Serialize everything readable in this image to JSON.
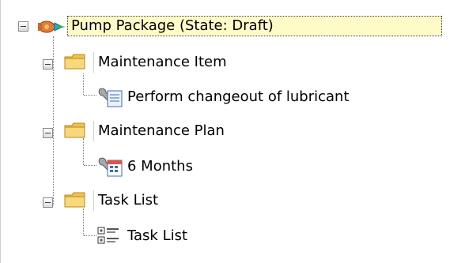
{
  "tree": {
    "root": {
      "label": "Pump Package (State: Draft)",
      "icon": "pump-package-icon"
    },
    "groups": [
      {
        "label": "Maintenance Item",
        "icon": "folder-icon",
        "child": {
          "label": "Perform changeout of lubricant",
          "icon": "maintenance-item-icon"
        }
      },
      {
        "label": "Maintenance Plan",
        "icon": "folder-icon",
        "child": {
          "label": "6 Months",
          "icon": "maintenance-plan-icon"
        }
      },
      {
        "label": "Task List",
        "icon": "folder-icon",
        "child": {
          "label": "Task List",
          "icon": "task-list-icon"
        }
      }
    ]
  },
  "colors": {
    "selection_bg": "#fffbc8",
    "folder": "#f5c542"
  }
}
